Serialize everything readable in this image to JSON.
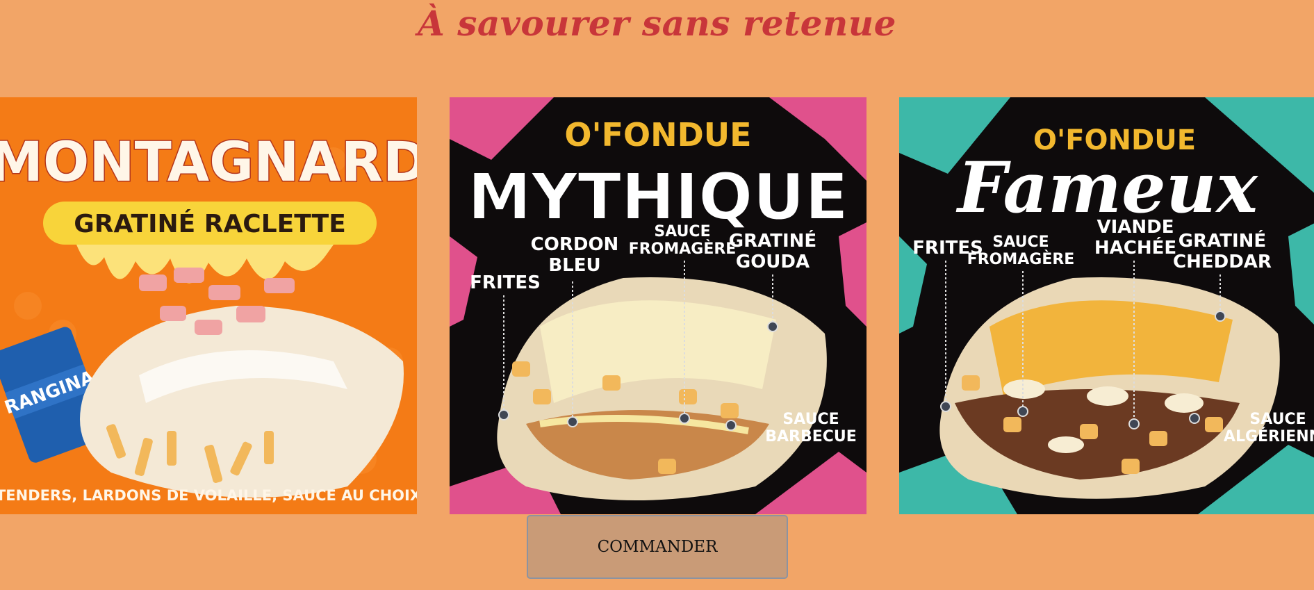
{
  "header": {
    "title": "À savourer sans retenue"
  },
  "products": [
    {
      "title": "MONTAGNARD",
      "subtitle": "GRATINÉ RACLETTE",
      "caption": "TENDERS, LARDONS DE VOLAILLE, SAUCE AU CHOIX",
      "can_label": "RANGINA",
      "background": "#F47B16"
    },
    {
      "brand": "O'FONDUE",
      "title": "MYTHIQUE",
      "labels": [
        "FRITES",
        "CORDON",
        "BLEU",
        "SAUCE",
        "FROMAGÈRE",
        "GRATINÉ",
        "GOUDA",
        "SAUCE",
        "BARBECUE"
      ],
      "accent": "#E0518C"
    },
    {
      "brand": "O'FONDUE",
      "title": "Fameux",
      "labels": [
        "FRITES",
        "SAUCE",
        "FROMAGÈRE",
        "VIANDE",
        "HACHÉE",
        "GRATINÉ",
        "CHEDDAR",
        "SAUCE",
        "ALGÉRIENNE"
      ],
      "accent": "#3DB8A8"
    }
  ],
  "actions": {
    "order_label": "COMMANDER"
  },
  "colors": {
    "page_bg": "#F2A567",
    "title": "#C8363A",
    "button_bg": "#C99B77"
  }
}
